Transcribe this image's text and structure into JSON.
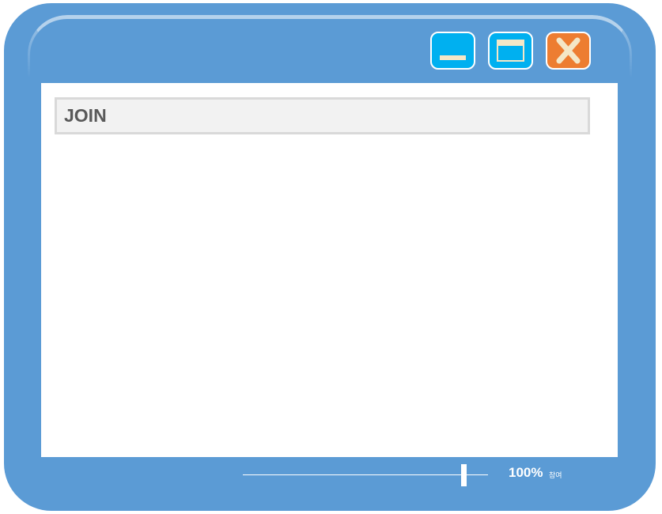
{
  "window": {
    "frame_color": "#5b9bd5",
    "controls": [
      {
        "name": "minimize",
        "icon": "minimize-icon",
        "color": "#00b0f0"
      },
      {
        "name": "maximize",
        "icon": "maximize-icon",
        "color": "#00b0f0"
      },
      {
        "name": "close",
        "icon": "close-icon",
        "color": "#ed7d31"
      }
    ]
  },
  "address_bar": {
    "value": "JOIN"
  },
  "zoom": {
    "level_label": "100%",
    "small_label": "참여",
    "slider_fraction": 0.9
  }
}
